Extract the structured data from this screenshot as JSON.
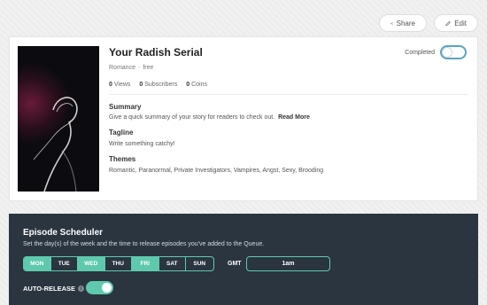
{
  "header": {
    "share_label": "Share",
    "edit_label": "Edit",
    "share_icon": "share-icon",
    "edit_icon": "pencil-icon"
  },
  "story": {
    "title": "Your Radish Serial",
    "genre": "Romance",
    "separator": "·",
    "price": "free",
    "completed_label": "Completed",
    "completed": false,
    "stats": {
      "views_count": "0",
      "views_label": "Views",
      "subscribers_count": "0",
      "subscribers_label": "Subscribers",
      "coins_count": "0",
      "coins_label": "Coins"
    },
    "summary_heading": "Summary",
    "summary_text": "Give a quick summary of your story for readers to check out.",
    "read_more": "Read More",
    "tagline_heading": "Tagline",
    "tagline_text": "Write something catchy!",
    "themes_heading": "Themes",
    "themes_text": "Romantic, Paranormal, Private Investigators, Vampires, Angst, Sexy, Brooding"
  },
  "scheduler": {
    "title": "Episode Scheduler",
    "description": "Set the day(s) of the week and the time to release episodes you've added to the Queue.",
    "days": [
      {
        "label": "MON",
        "selected": true
      },
      {
        "label": "TUE",
        "selected": false
      },
      {
        "label": "WED",
        "selected": true
      },
      {
        "label": "THU",
        "selected": false
      },
      {
        "label": "FRI",
        "selected": true
      },
      {
        "label": "SAT",
        "selected": false
      },
      {
        "label": "SUN",
        "selected": false
      }
    ],
    "timezone": "GMT",
    "time": "1am",
    "auto_release_label": "AUTO-RELEASE",
    "auto_release": true
  },
  "colors": {
    "accent": "#5fc9ad",
    "scheduler_bg": "#2a3540",
    "toggle_border": "#5ba3c6"
  }
}
